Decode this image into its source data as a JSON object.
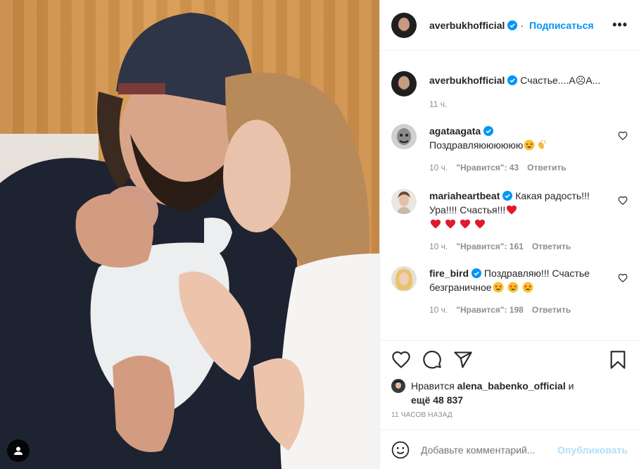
{
  "post": {
    "author": "averbukhofficial",
    "follow_label": "Подписаться",
    "more_label": "•••"
  },
  "caption": {
    "author": "averbukhofficial",
    "text": "Счастье....А☹А...",
    "time": "11 ч."
  },
  "comments": [
    {
      "user": "agataagata",
      "text": "Поздравляюююююю",
      "time": "10 ч.",
      "likes": "\"Нравится\": 43",
      "reply": "Ответить"
    },
    {
      "user": "mariaheartbeat",
      "text": "Какая радость!!! Ура!!!! Счастья!!!",
      "time": "10 ч.",
      "likes": "\"Нравится\": 161",
      "reply": "Ответить"
    },
    {
      "user": "fire_bird",
      "text": "Поздравляю!!! Счастье безграничное",
      "time": "10 ч.",
      "likes": "\"Нравится\": 198",
      "reply": "Ответить"
    }
  ],
  "likes_line": {
    "prefix": "Нравится",
    "user": "alena_babenko_official",
    "and": "и",
    "others": "ещё 48 837"
  },
  "time_ago": "11 ЧАСОВ НАЗАД",
  "add_comment": {
    "placeholder": "Добавьте комментарий...",
    "post_label": "Опубликовать"
  },
  "colors": {
    "accent": "#0095f6",
    "post_disabled": "#b2dffc",
    "heart": "#ed4956",
    "muted": "#8e8e8e"
  }
}
